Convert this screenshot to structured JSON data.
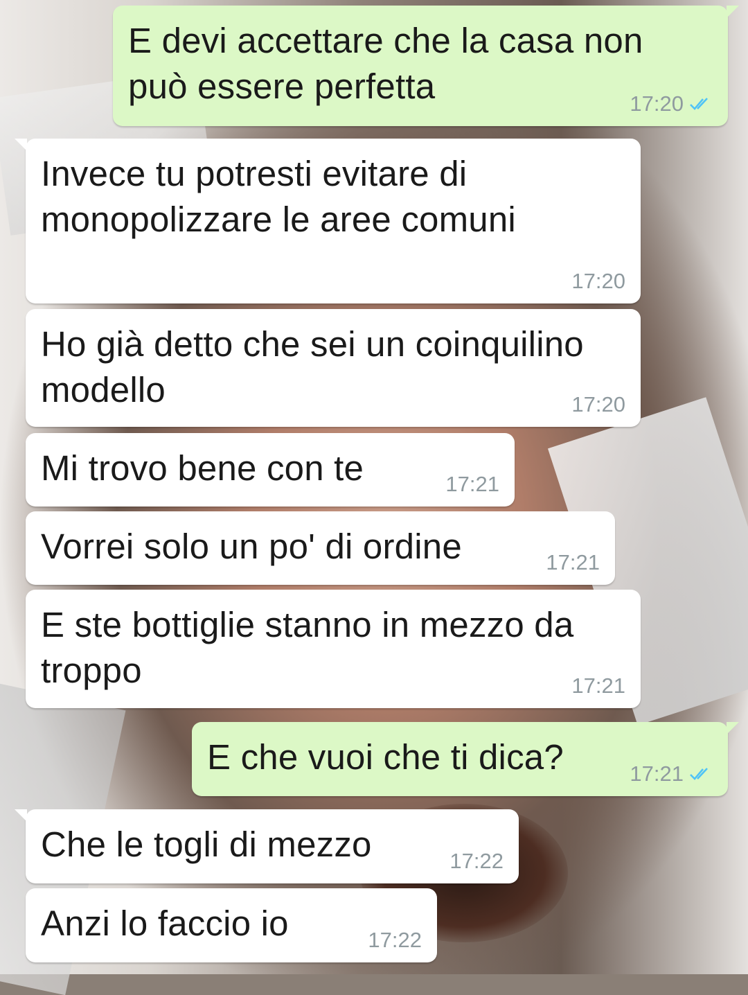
{
  "messages": [
    {
      "text": "E devi accettare che la casa non può essere perfetta",
      "time": "17:20",
      "read": "✓✓"
    },
    {
      "text": "Invece tu potresti evitare di monopolizzare le aree comuni",
      "time": "17:20"
    },
    {
      "text": "Ho già detto che sei un coinquilino modello",
      "time": "17:20"
    },
    {
      "text": "Mi trovo bene con te",
      "time": "17:21"
    },
    {
      "text": "Vorrei solo un po' di ordine",
      "time": "17:21"
    },
    {
      "text": "E ste bottiglie stanno in mezzo da troppo",
      "time": "17:21"
    },
    {
      "text": "E che vuoi che ti dica?",
      "time": "17:21",
      "read": "✓✓"
    },
    {
      "text": "Che le togli di mezzo",
      "time": "17:22"
    },
    {
      "text": "Anzi lo faccio io",
      "time": "17:22"
    }
  ],
  "colors": {
    "incoming_bubble": "#ffffff",
    "outgoing_bubble": "#dcf8c6",
    "read_ticks": "#4fc3f7",
    "timestamp": "#8f9a9f"
  }
}
